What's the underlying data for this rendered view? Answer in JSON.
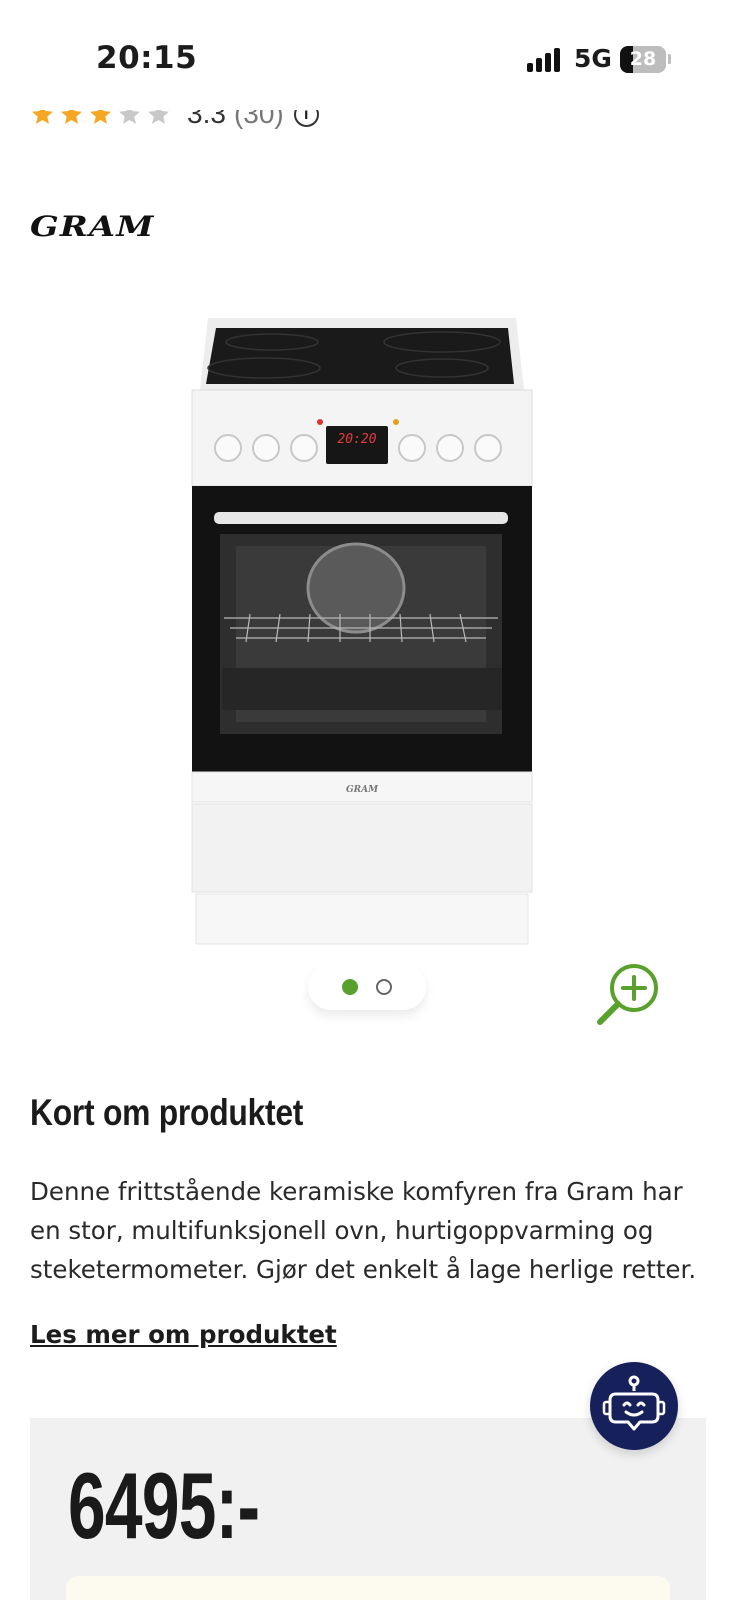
{
  "status_bar": {
    "time": "20:15",
    "network": "5G",
    "battery_level": "28",
    "battery_fraction": 0.28,
    "signal_bars": 4
  },
  "rating": {
    "score": "3.3",
    "count": "(30)",
    "stars_filled": 3,
    "stars_total": 5,
    "star_color": "#f5a623",
    "star_empty_color": "#c8c8c8",
    "info_symbol": "i"
  },
  "brand": {
    "logo_text": "GRAM",
    "oven_display": "20:20"
  },
  "carousel": {
    "active_index": 0,
    "total": 2,
    "accent_color": "#5aa02c"
  },
  "zoom": {
    "icon": "zoom-in-icon"
  },
  "product": {
    "section_title": "Kort om produktet",
    "description": "Denne frittstående keramiske komfyren fra Gram har en stor, multifunksjonell ovn, hurtigoppvarming og steketermometer. Gjør det enkelt å lage herlige retter.",
    "read_more_label": "Les mer om produktet"
  },
  "price": {
    "value": "6495:-"
  },
  "chatbot": {
    "icon": "chatbot-icon",
    "color": "#16205b"
  }
}
